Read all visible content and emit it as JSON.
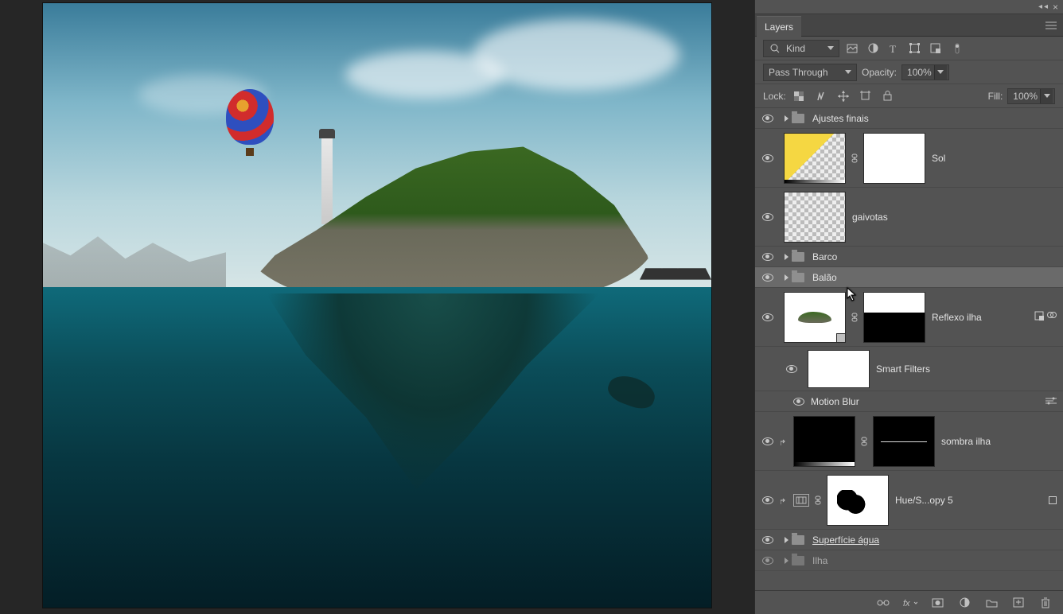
{
  "panel": {
    "tab": "Layers",
    "filter": {
      "kind": "Kind"
    },
    "blend": {
      "mode": "Pass Through",
      "opacity_label": "Opacity:",
      "opacity_value": "100%",
      "fill_label": "Fill:",
      "fill_value": "100%"
    },
    "lock": {
      "label": "Lock:"
    },
    "layers": [
      {
        "type": "group",
        "name": "Ajustes finais"
      },
      {
        "type": "adj-grad",
        "name": "Sol"
      },
      {
        "type": "pixel",
        "name": "gaivotas"
      },
      {
        "type": "group",
        "name": "Barco"
      },
      {
        "type": "group",
        "name": "Balão",
        "selected": true
      },
      {
        "type": "smart",
        "name": "Reflexo ilha"
      },
      {
        "type": "smartfilters-head",
        "name": "Smart Filters"
      },
      {
        "type": "filter",
        "name": "Motion Blur"
      },
      {
        "type": "clipped-grad",
        "name": "sombra ilha"
      },
      {
        "type": "clipped-adj",
        "name": "Hue/S...opy 5"
      },
      {
        "type": "group-underline",
        "name": "Superfície água"
      },
      {
        "type": "group-dim",
        "name": "Ilha"
      }
    ]
  }
}
